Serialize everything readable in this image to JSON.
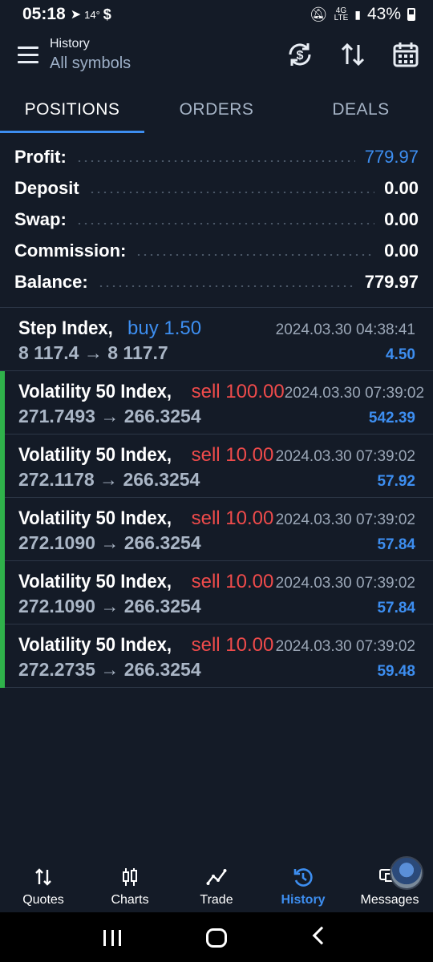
{
  "status": {
    "time": "05:18",
    "temp": "14°",
    "network": "4G LTE",
    "battery": "43%"
  },
  "header": {
    "title": "History",
    "subtitle": "All symbols"
  },
  "tabs": [
    {
      "label": "POSITIONS",
      "active": true
    },
    {
      "label": "ORDERS",
      "active": false
    },
    {
      "label": "DEALS",
      "active": false
    }
  ],
  "summary": {
    "profit_label": "Profit:",
    "profit_value": "779.97",
    "deposit_label": "Deposit",
    "deposit_value": "0.00",
    "swap_label": "Swap:",
    "swap_value": "0.00",
    "commission_label": "Commission:",
    "commission_value": "0.00",
    "balance_label": "Balance:",
    "balance_value": "779.97"
  },
  "positions": [
    {
      "symbol": "Step Index,",
      "side": "buy 1.50",
      "date": "2024.03.30 04:38:41",
      "prices": "8 117.4 → 8 117.7",
      "profit": "4.50"
    },
    {
      "symbol": "Volatility 50 Index,",
      "side": "sell 100.00",
      "date": "2024.03.30 07:39:02",
      "prices": "271.7493 → 266.3254",
      "profit": "542.39"
    },
    {
      "symbol": "Volatility 50 Index,",
      "side": "sell 10.00",
      "date": "2024.03.30 07:39:02",
      "prices": "272.1178 → 266.3254",
      "profit": "57.92"
    },
    {
      "symbol": "Volatility 50 Index,",
      "side": "sell 10.00",
      "date": "2024.03.30 07:39:02",
      "prices": "272.1090 → 266.3254",
      "profit": "57.84"
    },
    {
      "symbol": "Volatility 50 Index,",
      "side": "sell 10.00",
      "date": "2024.03.30 07:39:02",
      "prices": "272.1090 → 266.3254",
      "profit": "57.84"
    },
    {
      "symbol": "Volatility 50 Index,",
      "side": "sell 10.00",
      "date": "2024.03.30 07:39:02",
      "prices": "272.2735 → 266.3254",
      "profit": "59.48"
    }
  ],
  "nav": [
    {
      "label": "Quotes",
      "icon": "quotes-icon"
    },
    {
      "label": "Charts",
      "icon": "charts-icon"
    },
    {
      "label": "Trade",
      "icon": "trade-icon"
    },
    {
      "label": "History",
      "icon": "history-icon",
      "active": true
    },
    {
      "label": "Messages",
      "icon": "messages-icon"
    }
  ],
  "colors": {
    "background": "#141b27",
    "accent": "#3d8ef0",
    "sell": "#ef4b4b",
    "profit_bar": "#2fb24a"
  }
}
